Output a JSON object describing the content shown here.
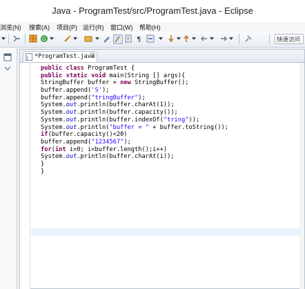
{
  "window": {
    "title": "Java  -  ProgramTest/src/ProgramTest.java  -  Eclipse"
  },
  "menu": {
    "items": [
      "浏览(N)",
      "搜索(A)",
      "项目(P)",
      "运行(R)",
      "窗口(W)",
      "帮助(H)"
    ]
  },
  "toolbar": {
    "quick_access_placeholder": "快速访问",
    "icons": [
      "hierarchy-icon",
      "build-icon",
      "run-icon",
      "open-type-icon",
      "search-icon",
      "editor-icon",
      "mark-occurrences-icon",
      "pilcrow-icon",
      "annotation-icon",
      "next-annotation-icon",
      "prev-annotation-icon",
      "back-icon",
      "forward-icon",
      "pin-icon"
    ]
  },
  "editor": {
    "tab_label": "*ProgramTest.java",
    "code_lines": [
      "public class ProgramTest {",
      "public static void main(String [] args){",
      "StringBuffer buffer = new StringBuffer();",
      "buffer.append('S');",
      "buffer.append(\"tringBuffer\");",
      "System.out.println(buffer.charAt(1));",
      "System.out.println(buffer.capacity());",
      "System.out.println(buffer.indexOf(\"tring\"));",
      "System.out.println(\"buffer = \" + buffer.toString());",
      "if(buffer.capacity()<20)",
      "buffer.append(\"1234567\");",
      "for(int i=0; i<buffer.length();i++)",
      "System.out.println(buffer.charAt(i));",
      "}",
      "}"
    ]
  },
  "colors": {
    "keyword": "#7f0055",
    "string": "#2a00ff",
    "field": "#0000c0",
    "current_line": "#e8f2fe"
  }
}
